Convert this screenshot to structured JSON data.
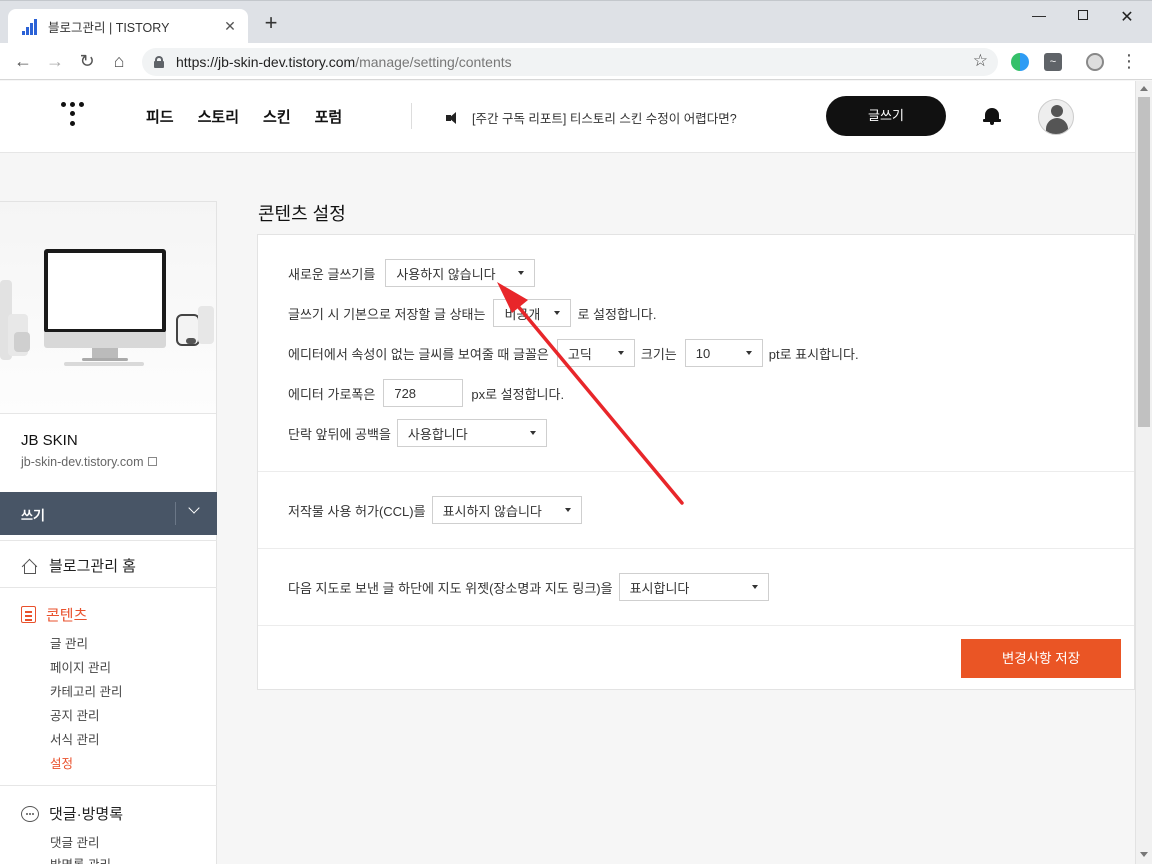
{
  "browser": {
    "tab_title": "블로그관리 | TISTORY",
    "tab_close": "✕",
    "new_tab": "+",
    "url_host": "https://jb-skin-dev.tistory.com",
    "url_path": "/manage/setting/contents",
    "back": "←",
    "forward": "→",
    "reload": "↻",
    "home": "⌂",
    "star": "☆",
    "menu": "⋮",
    "minimize": "—",
    "close": "✕"
  },
  "header": {
    "nav": [
      "피드",
      "스토리",
      "스킨",
      "포럼"
    ],
    "notice": "[주간 구독 리포트] 티스토리 스킨 수정이 어렵다면?",
    "write_label": "글쓰기"
  },
  "sidebar": {
    "blog_name": "JB SKIN",
    "blog_url": "jb-skin-dev.tistory.com",
    "write_label": "쓰기",
    "home_label": "블로그관리 홈",
    "contents_label": "콘텐츠",
    "contents_items": [
      "글 관리",
      "페이지 관리",
      "카테고리 관리",
      "공지 관리",
      "서식 관리",
      "설정"
    ],
    "comments_label": "댓글·방명록",
    "comments_items": [
      "댓글 관리",
      "방명록 관리"
    ]
  },
  "main": {
    "title": "콘텐츠 설정",
    "r1_label": "새로운 글쓰기를",
    "r1_select": "사용하지 않습니다",
    "r2_label": "글쓰기 시 기본으로 저장할 글 상태는",
    "r2_select": "비공개",
    "r2_suffix": "로 설정합니다.",
    "r3_label": "에디터에서 속성이 없는 글씨를 보여줄 때 글꼴은",
    "r3_font": "고딕",
    "r3_mid": "크기는",
    "r3_size": "10",
    "r3_suffix": "pt로 표시합니다.",
    "r4_label": "에디터 가로폭은",
    "r4_value": "728",
    "r4_suffix": "px로 설정합니다.",
    "r5_label": "단락 앞뒤에 공백을",
    "r5_select": "사용합니다",
    "r6_label": "저작물 사용 허가(CCL)를",
    "r6_select": "표시하지 않습니다",
    "r7_label": "다음 지도로 보낸 글 하단에 지도 위젯(장소명과 지도 링크)을",
    "r7_select": "표시합니다",
    "save_label": "변경사항 저장"
  },
  "colors": {
    "accent": "#ea5525",
    "sidebar_write_bar": "#485566",
    "annotation_arrow": "#e8262a"
  }
}
